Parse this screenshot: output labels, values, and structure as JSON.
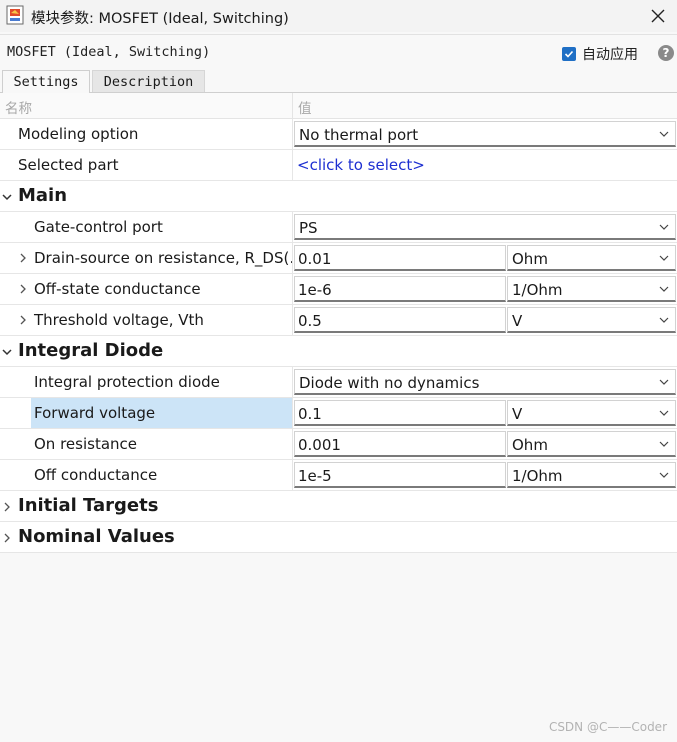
{
  "window": {
    "title": "模块参数: MOSFET (Ideal, Switching)"
  },
  "header": {
    "block_name": "MOSFET (Ideal, Switching)",
    "auto_apply_label": "自动应用",
    "auto_apply_checked": true,
    "help_label": "?"
  },
  "tabs": [
    {
      "label": "Settings",
      "active": true
    },
    {
      "label": "Description",
      "active": false
    }
  ],
  "table": {
    "col_name": "名称",
    "col_value": "值"
  },
  "rows": {
    "modeling_option": {
      "label": "Modeling option",
      "value": "No thermal port"
    },
    "selected_part": {
      "label": "Selected part",
      "value": "<click to select>"
    },
    "main": {
      "label": "Main"
    },
    "gate_control": {
      "label": "Gate-control port",
      "value": "PS"
    },
    "drain_source": {
      "label": "Drain-source on resistance, R_DS(…",
      "value": "0.01",
      "unit": "Ohm"
    },
    "off_state": {
      "label": "Off-state conductance",
      "value": "1e-6",
      "unit": "1/Ohm"
    },
    "threshold": {
      "label": "Threshold voltage, Vth",
      "value": "0.5",
      "unit": "V"
    },
    "integral_diode": {
      "label": "Integral Diode"
    },
    "protection_diode": {
      "label": "Integral protection diode",
      "value": "Diode with no dynamics"
    },
    "forward_voltage": {
      "label": "Forward voltage",
      "value": "0.1",
      "unit": "V"
    },
    "on_resistance": {
      "label": "On resistance",
      "value": "0.001",
      "unit": "Ohm"
    },
    "off_conductance": {
      "label": "Off conductance",
      "value": "1e-5",
      "unit": "1/Ohm"
    },
    "initial_targets": {
      "label": "Initial Targets"
    },
    "nominal_values": {
      "label": "Nominal Values"
    }
  },
  "watermark": "CSDN @C——Coder",
  "colors": {
    "accent": "#1f6fc5",
    "selection": "#cce4f7",
    "link": "#1d2fd1"
  }
}
